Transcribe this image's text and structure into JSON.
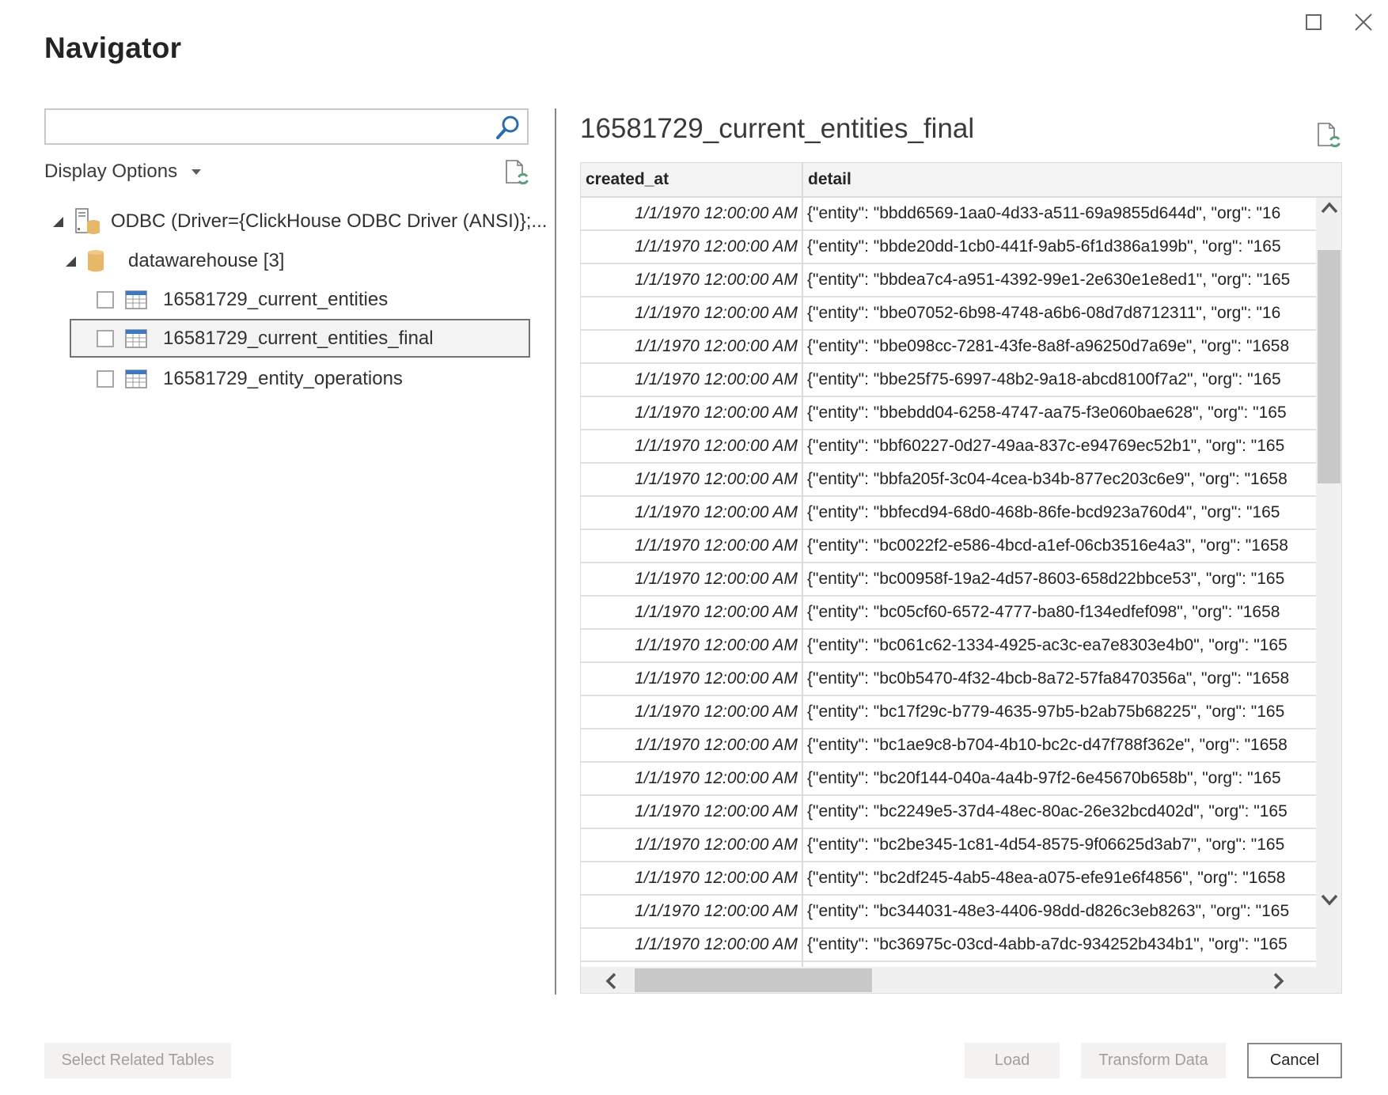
{
  "window": {
    "title": "Navigator",
    "maximize_icon": "maximize-icon",
    "close_icon": "close-icon"
  },
  "left_panel": {
    "search": {
      "value": "",
      "placeholder": "",
      "icon": "search-icon"
    },
    "display_options_label": "Display Options",
    "refresh_icon": "refresh-icon",
    "tree": {
      "source": {
        "label": "ODBC (Driver={ClickHouse ODBC Driver (ANSI)};...",
        "icon": "odbc-server-icon",
        "expanded": true
      },
      "database": {
        "label": "datawarehouse [3]",
        "icon": "database-icon",
        "expanded": true
      },
      "tables": [
        {
          "label": "16581729_current_entities",
          "checked": false,
          "selected": false
        },
        {
          "label": "16581729_current_entities_final",
          "checked": false,
          "selected": true
        },
        {
          "label": "16581729_entity_operations",
          "checked": false,
          "selected": false
        }
      ]
    }
  },
  "preview": {
    "title": "16581729_current_entities_final",
    "refresh_icon": "refresh-icon",
    "columns": [
      "created_at",
      "detail"
    ],
    "rows": [
      {
        "created_at": "1/1/1970 12:00:00 AM",
        "detail": "{\"entity\": \"bbdd6569-1aa0-4d33-a511-69a9855d644d\", \"org\": \"16"
      },
      {
        "created_at": "1/1/1970 12:00:00 AM",
        "detail": "{\"entity\": \"bbde20dd-1cb0-441f-9ab5-6f1d386a199b\", \"org\": \"165"
      },
      {
        "created_at": "1/1/1970 12:00:00 AM",
        "detail": "{\"entity\": \"bbdea7c4-a951-4392-99e1-2e630e1e8ed1\", \"org\": \"165"
      },
      {
        "created_at": "1/1/1970 12:00:00 AM",
        "detail": "{\"entity\": \"bbe07052-6b98-4748-a6b6-08d7d8712311\", \"org\": \"16"
      },
      {
        "created_at": "1/1/1970 12:00:00 AM",
        "detail": "{\"entity\": \"bbe098cc-7281-43fe-8a8f-a96250d7a69e\", \"org\": \"1658"
      },
      {
        "created_at": "1/1/1970 12:00:00 AM",
        "detail": "{\"entity\": \"bbe25f75-6997-48b2-9a18-abcd8100f7a2\", \"org\": \"165"
      },
      {
        "created_at": "1/1/1970 12:00:00 AM",
        "detail": "{\"entity\": \"bbebdd04-6258-4747-aa75-f3e060bae628\", \"org\": \"165"
      },
      {
        "created_at": "1/1/1970 12:00:00 AM",
        "detail": "{\"entity\": \"bbf60227-0d27-49aa-837c-e94769ec52b1\", \"org\": \"165"
      },
      {
        "created_at": "1/1/1970 12:00:00 AM",
        "detail": "{\"entity\": \"bbfa205f-3c04-4cea-b34b-877ec203c6e9\", \"org\": \"1658"
      },
      {
        "created_at": "1/1/1970 12:00:00 AM",
        "detail": "{\"entity\": \"bbfecd94-68d0-468b-86fe-bcd923a760d4\", \"org\": \"165"
      },
      {
        "created_at": "1/1/1970 12:00:00 AM",
        "detail": "{\"entity\": \"bc0022f2-e586-4bcd-a1ef-06cb3516e4a3\", \"org\": \"1658"
      },
      {
        "created_at": "1/1/1970 12:00:00 AM",
        "detail": "{\"entity\": \"bc00958f-19a2-4d57-8603-658d22bbce53\", \"org\": \"165"
      },
      {
        "created_at": "1/1/1970 12:00:00 AM",
        "detail": "{\"entity\": \"bc05cf60-6572-4777-ba80-f134edfef098\", \"org\": \"1658"
      },
      {
        "created_at": "1/1/1970 12:00:00 AM",
        "detail": "{\"entity\": \"bc061c62-1334-4925-ac3c-ea7e8303e4b0\", \"org\": \"165"
      },
      {
        "created_at": "1/1/1970 12:00:00 AM",
        "detail": "{\"entity\": \"bc0b5470-4f32-4bcb-8a72-57fa8470356a\", \"org\": \"1658"
      },
      {
        "created_at": "1/1/1970 12:00:00 AM",
        "detail": "{\"entity\": \"bc17f29c-b779-4635-97b5-b2ab75b68225\", \"org\": \"165"
      },
      {
        "created_at": "1/1/1970 12:00:00 AM",
        "detail": "{\"entity\": \"bc1ae9c8-b704-4b10-bc2c-d47f788f362e\", \"org\": \"1658"
      },
      {
        "created_at": "1/1/1970 12:00:00 AM",
        "detail": "{\"entity\": \"bc20f144-040a-4a4b-97f2-6e45670b658b\", \"org\": \"165"
      },
      {
        "created_at": "1/1/1970 12:00:00 AM",
        "detail": "{\"entity\": \"bc2249e5-37d4-48ec-80ac-26e32bcd402d\", \"org\": \"165"
      },
      {
        "created_at": "1/1/1970 12:00:00 AM",
        "detail": "{\"entity\": \"bc2be345-1c81-4d54-8575-9f06625d3ab7\", \"org\": \"165"
      },
      {
        "created_at": "1/1/1970 12:00:00 AM",
        "detail": "{\"entity\": \"bc2df245-4ab5-48ea-a075-efe91e6f4856\", \"org\": \"1658"
      },
      {
        "created_at": "1/1/1970 12:00:00 AM",
        "detail": "{\"entity\": \"bc344031-48e3-4406-98dd-d826c3eb8263\", \"org\": \"165"
      },
      {
        "created_at": "1/1/1970 12:00:00 AM",
        "detail": "{\"entity\": \"bc36975c-03cd-4abb-a7dc-934252b434b1\", \"org\": \"165"
      }
    ]
  },
  "footer": {
    "select_related_label": "Select Related Tables",
    "load_label": "Load",
    "transform_label": "Transform Data",
    "cancel_label": "Cancel"
  },
  "colors": {
    "accent_blue": "#2b6cb0",
    "database_tan": "#e8b86a",
    "refresh_green": "#5a9e7c"
  }
}
